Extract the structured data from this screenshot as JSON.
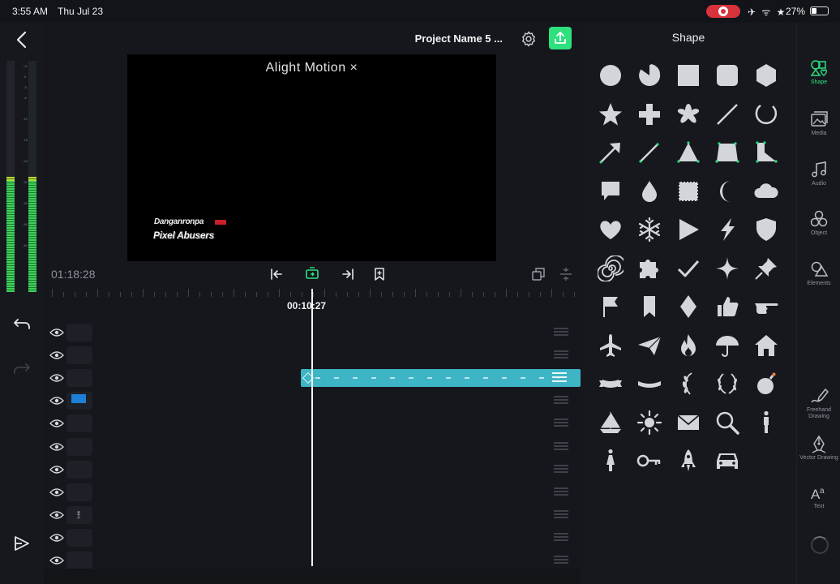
{
  "status_bar": {
    "time": "3:55 AM",
    "date": "Thu Jul 23",
    "icons": "✈ ᯤ ★",
    "battery": "27%"
  },
  "header": {
    "project_name": "Project Name 5 ..."
  },
  "preview": {
    "watermark": "Alight Motion ×",
    "logo_top": "Danganronpa",
    "logo_bottom": "Pixel Abusers"
  },
  "timeline": {
    "total_time": "01:18:28",
    "current_time": "00:10:27",
    "layer_count": 11
  },
  "shape_panel": {
    "title": "Shape",
    "shapes": [
      "circle",
      "pie",
      "square",
      "rounded-square",
      "hexagon",
      "star",
      "plus",
      "flower",
      "line",
      "arc",
      "arrow",
      "pencil-line",
      "triangle-mesh",
      "trapezoid-mesh",
      "corner-mesh",
      "speech-bubble",
      "drop",
      "stamp",
      "crescent",
      "cloud",
      "heart",
      "snowflake",
      "play",
      "lightning",
      "shield",
      "spiral",
      "puzzle",
      "check",
      "sparkle",
      "pushpin",
      "flag",
      "bookmark",
      "diamond",
      "thumbs-up",
      "pointing-hand",
      "airplane",
      "paper-plane",
      "flame",
      "umbrella",
      "house",
      "ribbon",
      "banner",
      "laurel-half",
      "laurel",
      "bomb",
      "sailboat",
      "sun",
      "envelope",
      "magnifier",
      "man",
      "woman",
      "key",
      "rocket",
      "car"
    ]
  },
  "categories": [
    {
      "label": "Shape",
      "icon": "shape-icon"
    },
    {
      "label": "Media",
      "icon": "media-icon"
    },
    {
      "label": "Audio",
      "icon": "audio-icon"
    },
    {
      "label": "Object",
      "icon": "object-icon"
    },
    {
      "label": "Elements",
      "icon": "elements-icon"
    },
    {
      "label": "Freehand Drawing",
      "icon": "freehand-drawing-icon"
    },
    {
      "label": "Vector Drawing",
      "icon": "vector-drawing-icon"
    },
    {
      "label": "Text",
      "icon": "text-icon"
    }
  ],
  "colors": {
    "accent": "#2fe07f",
    "clip": "#3db5c5",
    "background": "#15171d",
    "preview": "#000000"
  }
}
